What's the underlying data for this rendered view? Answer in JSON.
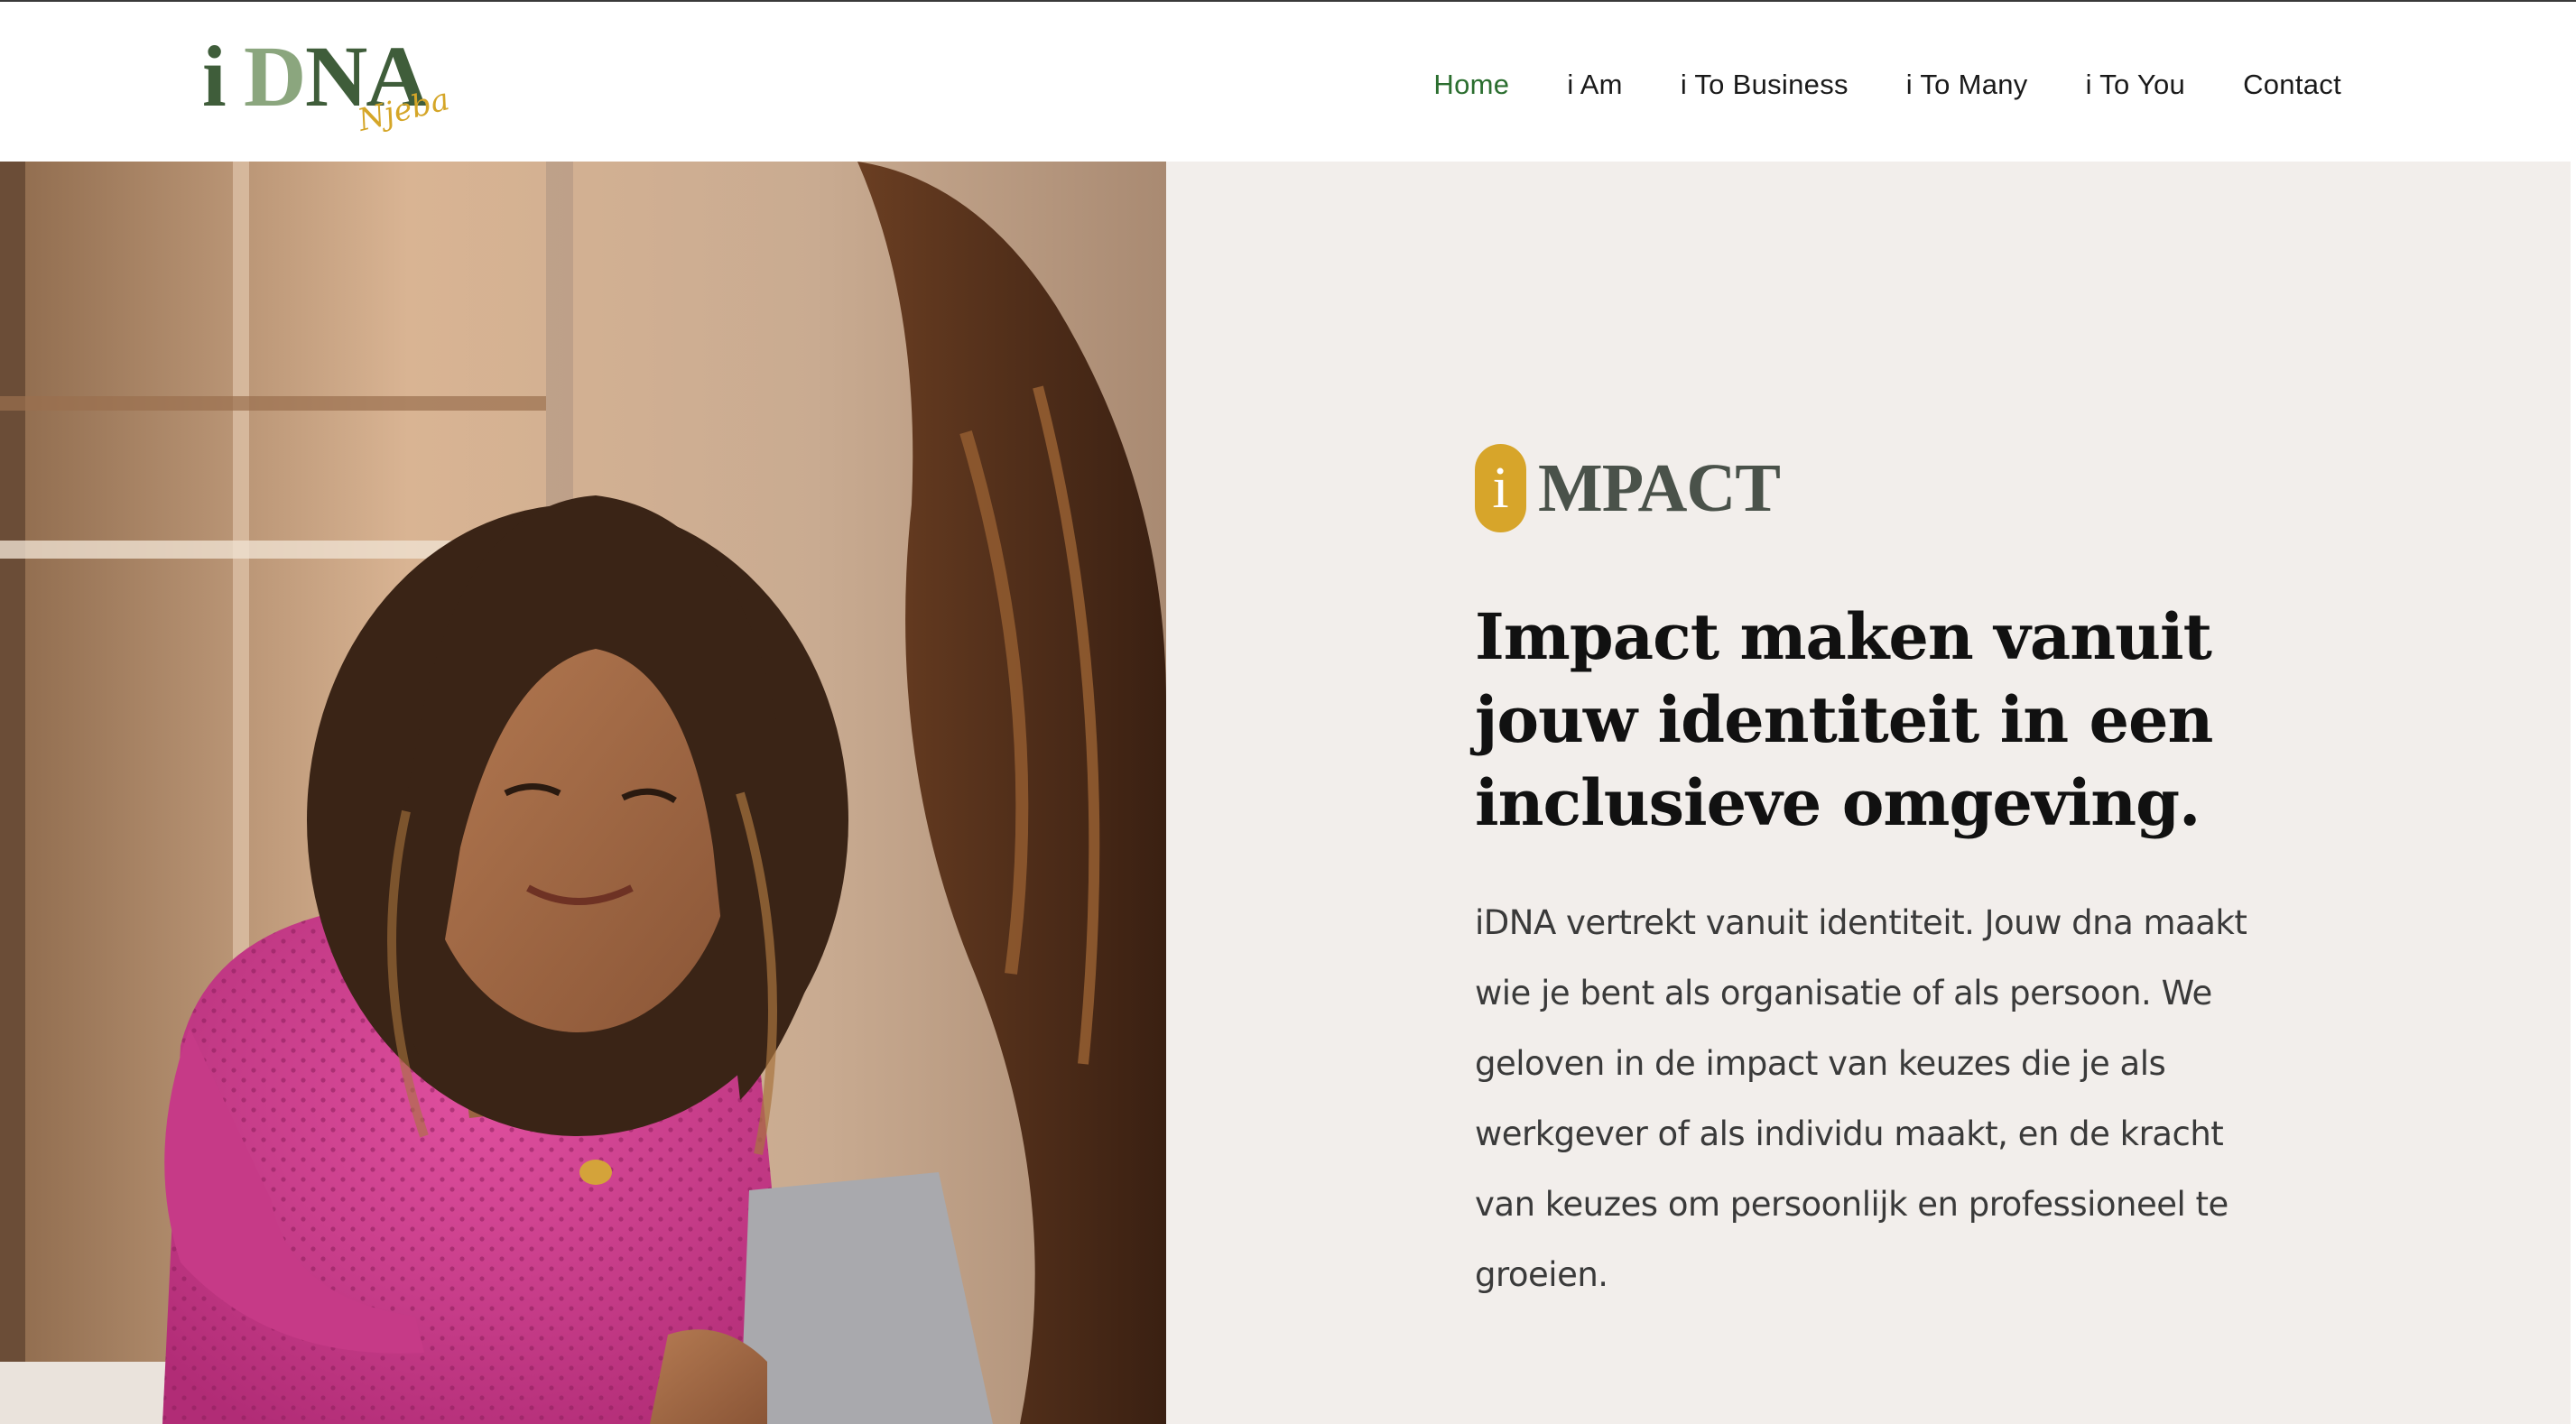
{
  "header": {
    "logo": {
      "wordmark": "iDNA",
      "signature": "Njeba"
    },
    "nav": [
      {
        "label": "Home",
        "active": true
      },
      {
        "label": "i Am",
        "active": false
      },
      {
        "label": "i To Business",
        "active": false
      },
      {
        "label": "i To Many",
        "active": false
      },
      {
        "label": "i To You",
        "active": false
      },
      {
        "label": "Contact",
        "active": false
      }
    ]
  },
  "hero": {
    "image_alt": "",
    "badge_letter": "i",
    "badge_word": "MPACT",
    "headline": "Impact maken vanuit jouw identiteit in een inclusieve omgeving.",
    "body": "iDNA vertrekt vanuit identiteit. Jouw dna maakt wie je bent als organisatie of als persoon. We geloven in de impact van keuzes die je als werkgever of als individu maakt, en de kracht van keuzes om persoonlijk en professioneel te groeien."
  },
  "colors": {
    "nav_active": "#2b6e2f",
    "nav_text": "#1a1a1a",
    "panel_bg": "#f2eeeb",
    "badge_gold": "#d7a52a",
    "logo_green": "#3f5d3a"
  }
}
